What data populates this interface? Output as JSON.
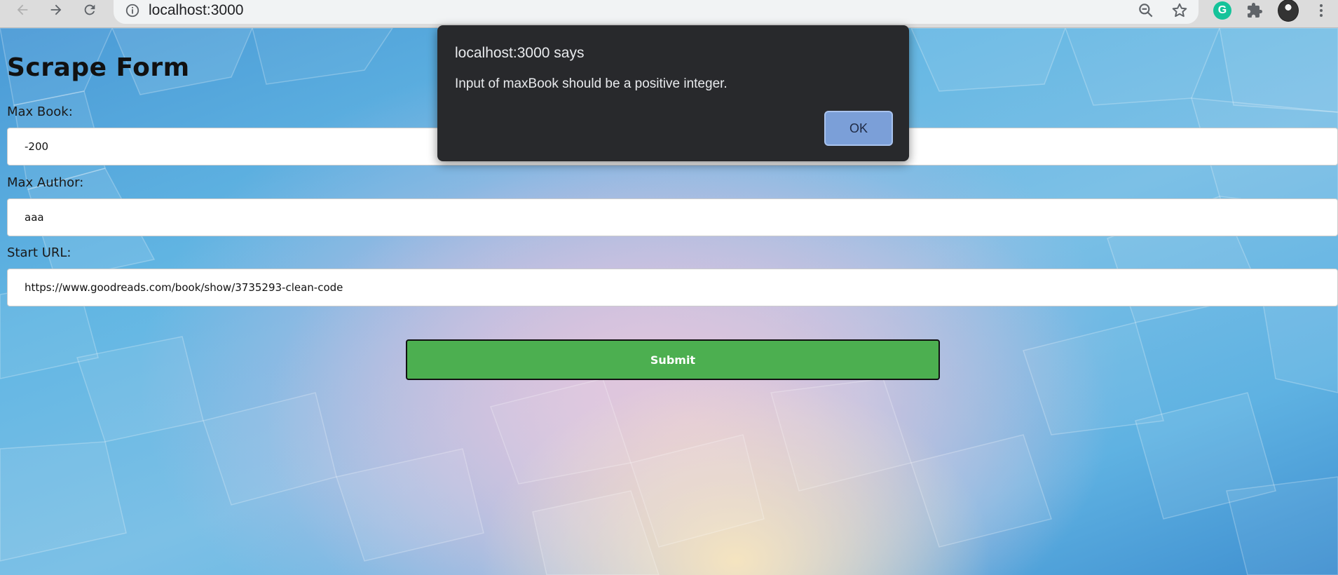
{
  "browser": {
    "url": "localhost:3000",
    "icons": {
      "back": "back-arrow-icon",
      "forward": "forward-arrow-icon",
      "reload": "reload-icon",
      "site_info": "info-icon",
      "zoom": "zoom-out-icon",
      "bookmark": "star-icon",
      "extension_grammarly": "grammarly-icon",
      "extensions": "puzzle-icon",
      "profile": "avatar",
      "menu": "kebab-menu-icon"
    },
    "grammarly_letter": "G"
  },
  "form": {
    "title": "Scrape Form",
    "fields": [
      {
        "label": "Max Book:",
        "value": "-200"
      },
      {
        "label": "Max Author:",
        "value": "aaa"
      },
      {
        "label": "Start URL:",
        "value": "https://www.goodreads.com/book/show/3735293-clean-code"
      }
    ],
    "submit_label": "Submit",
    "colors": {
      "submit": "#4caf50"
    }
  },
  "dialog": {
    "title": "localhost:3000 says",
    "message": "Input of maxBook should be a positive integer.",
    "ok_label": "OK",
    "colors": {
      "background": "#28292c",
      "ok_button": "#7b9fd8"
    }
  }
}
